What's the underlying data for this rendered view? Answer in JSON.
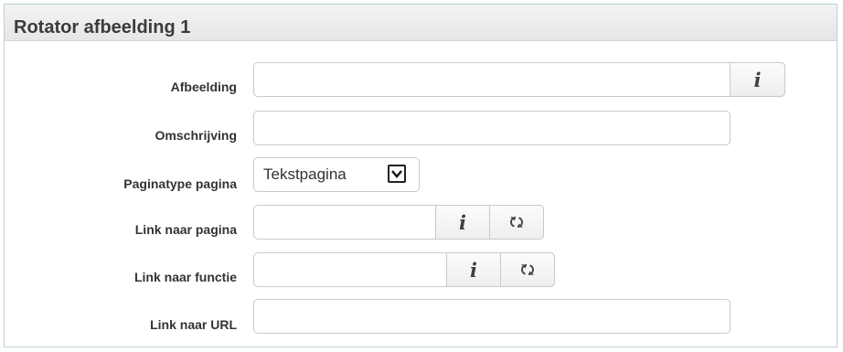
{
  "panel": {
    "title": "Rotator afbeelding 1"
  },
  "form": {
    "afbeelding": {
      "label": "Afbeelding",
      "value": "",
      "info_icon": "info-icon"
    },
    "omschrijving": {
      "label": "Omschrijving",
      "value": ""
    },
    "paginatype": {
      "label": "Paginatype pagina",
      "selected": "Tekstpagina"
    },
    "link_pagina": {
      "label": "Link naar pagina",
      "value": "",
      "info_icon": "info-icon",
      "refresh_icon": "refresh-icon"
    },
    "link_functie": {
      "label": "Link naar functie",
      "value": "",
      "info_icon": "info-icon",
      "refresh_icon": "refresh-icon"
    },
    "link_url": {
      "label": "Link naar URL",
      "value": ""
    }
  },
  "glyphs": {
    "info": "i"
  }
}
